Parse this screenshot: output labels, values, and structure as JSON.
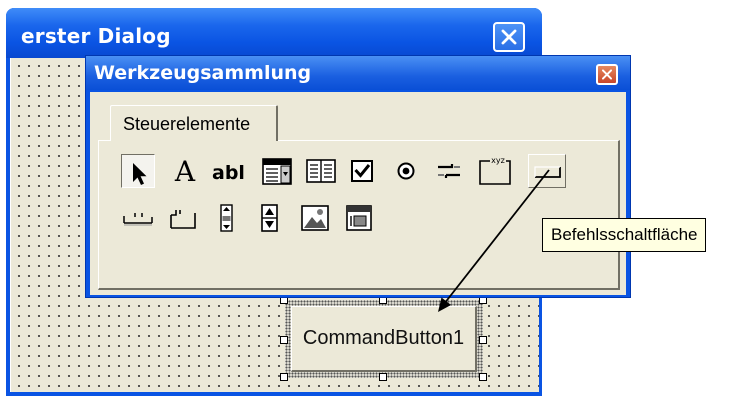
{
  "form": {
    "title": "erster Dialog",
    "close_icon": "close-icon",
    "command_button_label": "CommandButton1"
  },
  "toolbox": {
    "title": "Werkzeugsammlung",
    "close_icon": "close-icon",
    "tab_label": "Steuerelemente",
    "tools_row1": [
      "pointer-icon",
      "label-icon",
      "textbox-icon",
      "combobox-icon",
      "listbox-icon",
      "checkbox-icon",
      "optionbutton-icon",
      "togglebutton-icon",
      "frame-icon",
      "commandbutton-icon"
    ],
    "tools_row2": [
      "tabstrip-icon",
      "multipage-icon",
      "scrollbar-icon",
      "spinbutton-icon",
      "image-icon",
      "refedit-icon"
    ],
    "label_glyph": "A",
    "textbox_glyph": "abl",
    "frame_glyph": "xyz"
  },
  "tooltip": {
    "text": "Befehlsschaltfläche"
  },
  "colors": {
    "titlebar_blue": "#0a54e3",
    "face": "#ece9d8",
    "tooltip_bg": "#ffffe1"
  }
}
